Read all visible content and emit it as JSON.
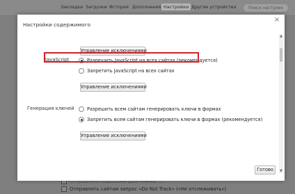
{
  "nav": {
    "tabs": [
      "Закладки",
      "Загрузки",
      "История",
      "Дополнения",
      "Настройки",
      "Другие устройства"
    ],
    "active_tab": "Настройки",
    "search_placeholder": "Поиск настроек"
  },
  "background": {
    "bottom_row_partial": "Отправлять подсказки для поиска ...",
    "dnt_label": "Отправлять сайтам запрос «Do Not Track» («Не отслеживать»)"
  },
  "dialog": {
    "title": "Настройки содержимого",
    "top_button": "Управление исключениями",
    "javascript": {
      "section_label": "JavaScript",
      "allow_label": "Разрешить JavaScript на всех сайтах (рекомендуется)",
      "deny_label": "Запретить JavaScript на всех сайтах",
      "selected": "allow",
      "exceptions_button": "Управление исключениями"
    },
    "keygen": {
      "section_label": "Генерация ключей",
      "allow_label": "Разрешить всем сайтам генерировать ключи в формах",
      "deny_label": "Запретить всем сайтам генерировать ключи в формах (рекомендуется)",
      "selected": "deny",
      "exceptions_button": "Управление исключениями"
    },
    "done_button": "Готово"
  },
  "colors": {
    "highlight": "#d21f2b",
    "overlay": "#7f7f7f"
  }
}
